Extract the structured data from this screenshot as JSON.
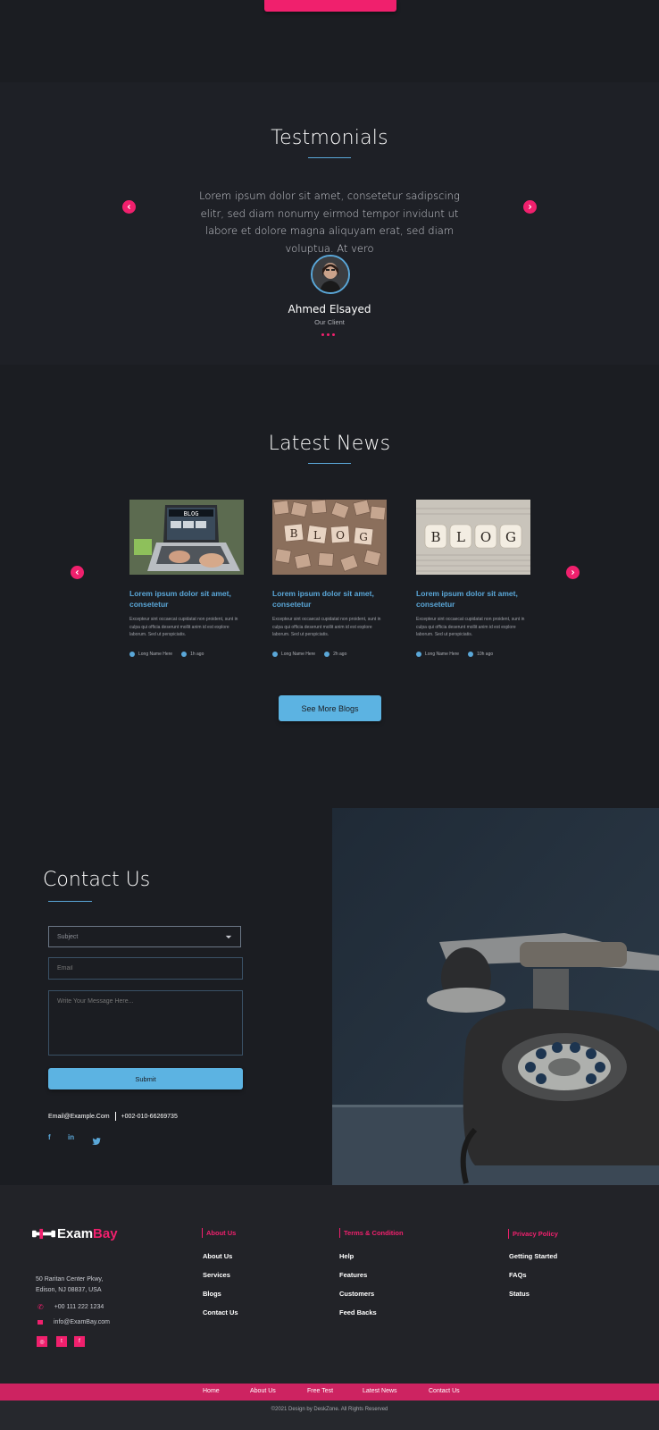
{
  "top": {
    "cta_button": ""
  },
  "testimonials": {
    "title": "Testmonials",
    "quote": "Lorem ipsum dolor sit amet, consetetur sadipscing elitr, sed diam nonumy eirmod tempor invidunt ut labore et dolore magna aliquyam erat, sed diam voluptua. At vero",
    "client_name": "Ahmed Elsayed",
    "client_role": "Our Client"
  },
  "news": {
    "title": "Latest News",
    "cards": [
      {
        "image_label": "BLOG",
        "title": "Lorem ipsum dolor sit amet, consetetur",
        "text": "Excepteur sint occaecat cupidatat non proident, sunt in culpa qui officia deserunt mollit anim id est explore laborum. Sed ut perspiciatis.",
        "author": "Long Name Here",
        "time": "1h ago"
      },
      {
        "image_label": "BLOG",
        "title": "Lorem ipsum dolor sit amet, consetetur",
        "text": "Excepteur sint occaecat cupidatat non proident, sunt in culpa qui officia deserunt mollit anim id est explore laborum. Sed ut perspiciatis.",
        "author": "Long Name Here",
        "time": "2h ago"
      },
      {
        "image_label": "BLOG",
        "title": "Lorem ipsum dolor sit amet, consetetur",
        "text": "Excepteur sint occaecat cupidatat non proident, sunt in culpa qui officia deserunt mollit anim id est explore laborum. Sed ut perspiciatis.",
        "author": "Long Name Here",
        "time": "10h ago"
      }
    ],
    "see_more": "See More Blogs"
  },
  "contact": {
    "title": "Contact Us",
    "subject_placeholder": "Subject",
    "email_placeholder": "Email",
    "message_placeholder": "Write Your Message Here...",
    "submit": "Submit",
    "email": "Email@Example.Com",
    "phone": "+002-010-66269735",
    "social": [
      "f",
      "in",
      "t"
    ]
  },
  "footer": {
    "logo_part1": "Exam",
    "logo_part2": "Bay",
    "address_line1": "50 Raritan Center Pkwy,",
    "address_line2": "Edison, NJ 08837, USA",
    "phone": "+00 111 222 1234",
    "email": "info@ExamBay.com",
    "columns": [
      {
        "heading": "About Us",
        "links": [
          "About Us",
          "Services",
          "Blogs",
          "Contact Us"
        ]
      },
      {
        "heading": "Terms & Condition",
        "links": [
          "Help",
          "Features",
          "Customers",
          "Feed Backs"
        ]
      },
      {
        "heading": "Privacy Policy",
        "links": [
          "Getting Started",
          "FAQs",
          "Status"
        ]
      }
    ],
    "bottom_links": [
      "Home",
      "About Us",
      "Free Test",
      "Latest News",
      "Contact Us"
    ],
    "copyright": "©2021 Design by DeskZone. All Rights Reserved"
  },
  "colors": {
    "accent_pink": "#f0206d",
    "accent_blue": "#5cb3e2",
    "background": "#1b1d22"
  }
}
